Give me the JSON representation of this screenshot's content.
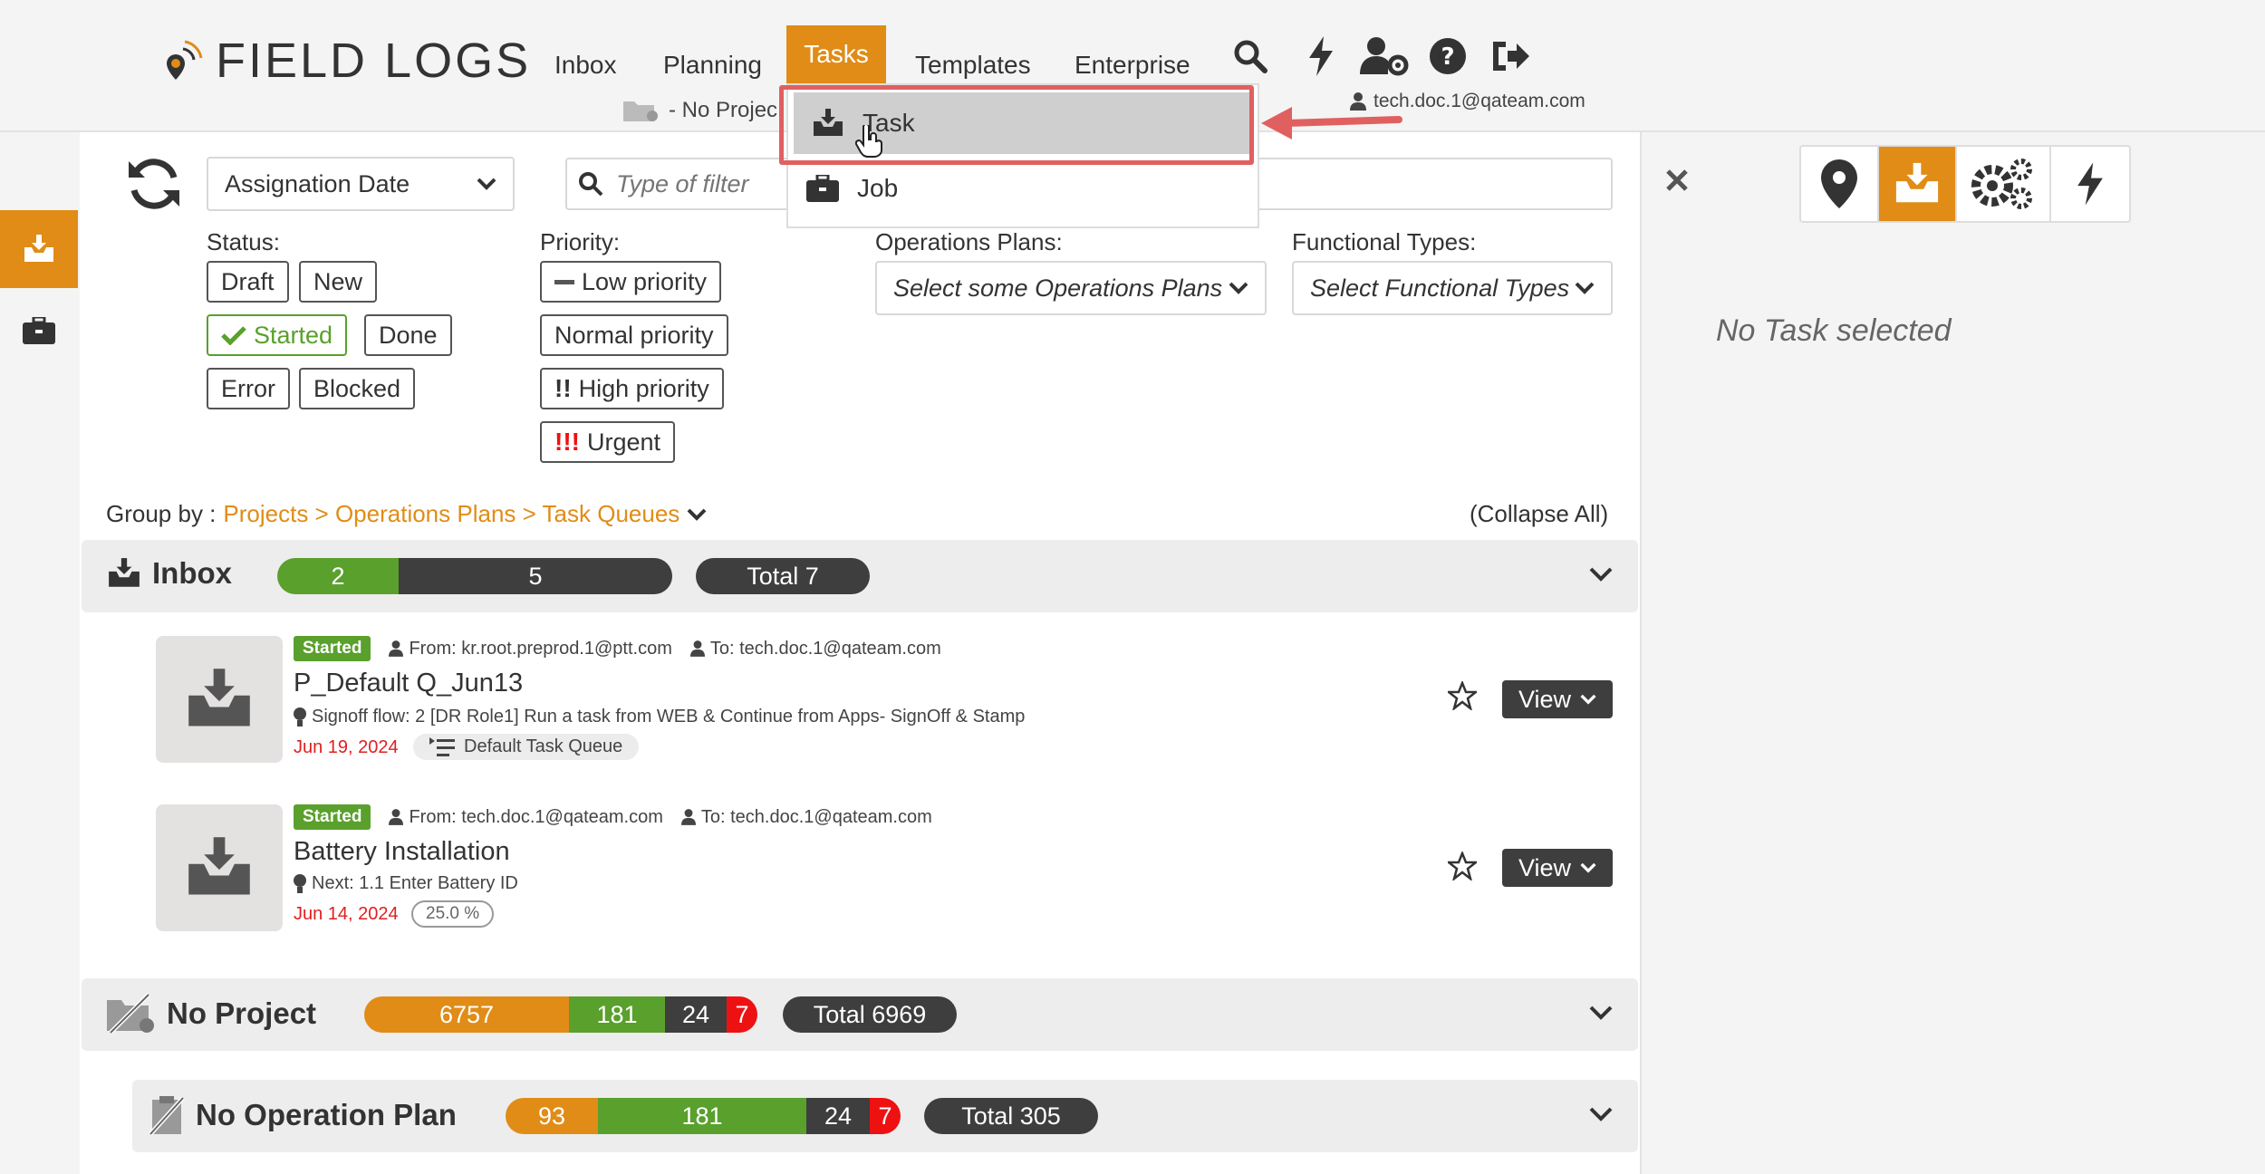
{
  "header": {
    "logo_text": "FIELD LOGS",
    "nav": [
      "Inbox",
      "Planning",
      "Tasks",
      "Templates",
      "Enterprise"
    ],
    "user_email": "tech.doc.1@qateam.com",
    "project_label": "- No Projec"
  },
  "dropdown": {
    "task_label": "Task",
    "job_label": "Job"
  },
  "filters": {
    "sort_value": "Assignation Date",
    "filter_placeholder": "Type of filter",
    "status_label": "Status:",
    "status_tags": [
      "Draft",
      "New",
      "Started",
      "Done",
      "Error",
      "Blocked"
    ],
    "priority_label": "Priority:",
    "priority_tags": [
      "Low priority",
      "Normal priority",
      "High priority",
      "Urgent"
    ],
    "ops_label": "Operations Plans:",
    "ops_placeholder": "Select some Operations Plans",
    "func_label": "Functional Types:",
    "func_placeholder": "Select Functional Types"
  },
  "groupby": {
    "prefix": "Group by :",
    "path": "Projects > Operations Plans > Task Queues",
    "collapse_all": "(Collapse All)"
  },
  "inbox_group": {
    "title": "Inbox",
    "green": "2",
    "dark": "5",
    "total": "Total 7"
  },
  "tasks": [
    {
      "status": "Started",
      "from": "From: kr.root.preprod.1@ptt.com",
      "to": "To: tech.doc.1@qateam.com",
      "title": "P_Default Q_Jun13",
      "info": "Signoff flow: 2 [DR Role1] Run a task from WEB & Continue from Apps- SignOff & Stamp",
      "date": "Jun 19, 2024",
      "queue": "Default Task Queue",
      "view": "View"
    },
    {
      "status": "Started",
      "from": "From: tech.doc.1@qateam.com",
      "to": "To: tech.doc.1@qateam.com",
      "title": "Battery Installation",
      "info": "Next: 1.1 Enter Battery ID",
      "date": "Jun 14, 2024",
      "progress": "25.0 %",
      "view": "View"
    }
  ],
  "no_project_group": {
    "title": "No Project",
    "orange": "6757",
    "green": "181",
    "dark": "24",
    "red": "7",
    "total": "Total 6969"
  },
  "no_opplan_group": {
    "title": "No Operation Plan",
    "orange": "93",
    "green": "181",
    "dark": "24",
    "red": "7",
    "total": "Total 305"
  },
  "right_panel": {
    "empty_text": "No Task selected"
  },
  "colors": {
    "accent": "#e08c17",
    "green": "#5aa02c",
    "dark": "#3e3e3e",
    "red": "#ee1111"
  }
}
